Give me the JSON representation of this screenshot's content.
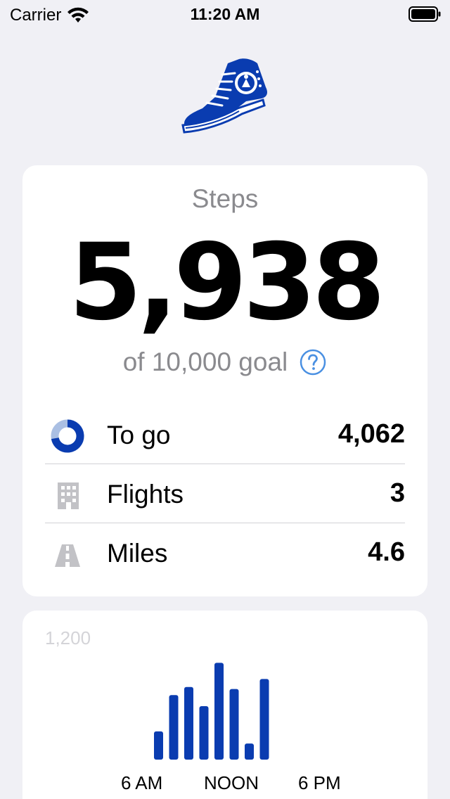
{
  "status_bar": {
    "carrier": "Carrier",
    "time": "11:20 AM"
  },
  "steps": {
    "title": "Steps",
    "count": "5,938",
    "goal_text": "of 10,000 goal"
  },
  "stats": [
    {
      "label": "To go",
      "value": "4,062",
      "icon": "progress-ring-icon"
    },
    {
      "label": "Flights",
      "value": "3",
      "icon": "building-icon"
    },
    {
      "label": "Miles",
      "value": "4.6",
      "icon": "road-icon"
    }
  ],
  "colors": {
    "accent": "#0a3cb0",
    "accent_light": "#aabfe3",
    "help_blue": "#4a90e2",
    "muted_text": "#8a8a8e",
    "icon_gray": "#c2c2c6"
  },
  "chart_data": {
    "type": "bar",
    "y_max_label": "1,200",
    "ylim": [
      0,
      1200
    ],
    "x_ticks": [
      "6 AM",
      "NOON",
      "6 PM"
    ],
    "values": [
      280,
      640,
      720,
      530,
      960,
      700,
      160,
      800
    ]
  }
}
